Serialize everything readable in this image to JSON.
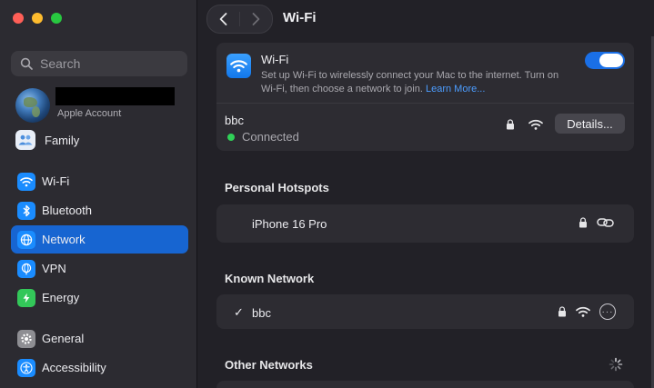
{
  "window": {
    "traffic_lights": {
      "close": "#ff5f57",
      "minimize": "#febc2e",
      "zoom": "#28c840"
    }
  },
  "sidebar": {
    "search": {
      "placeholder": "Search",
      "value": ""
    },
    "account": {
      "subtitle": "Apple Account"
    },
    "family": {
      "label": "Family"
    },
    "items": [
      {
        "label": "Wi-Fi",
        "icon": "wifi-icon",
        "color": "#1a8cff",
        "selected": false
      },
      {
        "label": "Bluetooth",
        "icon": "bluetooth-icon",
        "color": "#1a8cff",
        "selected": false
      },
      {
        "label": "Network",
        "icon": "globe-icon",
        "color": "#1a8cff",
        "selected": true
      },
      {
        "label": "VPN",
        "icon": "globe-vpn-icon",
        "color": "#1a8cff",
        "selected": false
      },
      {
        "label": "Energy",
        "icon": "energy-icon",
        "color": "#33c759",
        "selected": false
      },
      {
        "label": "General",
        "icon": "gear-icon",
        "color": "#8e8e93",
        "selected": false
      },
      {
        "label": "Accessibility",
        "icon": "accessibility-icon",
        "color": "#1a8cff",
        "selected": false
      }
    ]
  },
  "header": {
    "title": "Wi-Fi"
  },
  "wifi_panel": {
    "title": "Wi-Fi",
    "description": "Set up Wi-Fi to wirelessly connect your Mac to the internet. Turn on Wi-Fi, then choose a network to join.",
    "learn_more": "Learn More...",
    "enabled": true,
    "current_network": {
      "name": "bbc",
      "status": "Connected",
      "details_label": "Details..."
    }
  },
  "personal_hotspots": {
    "heading": "Personal Hotspots",
    "items": [
      {
        "name": "iPhone 16 Pro"
      }
    ]
  },
  "known_network": {
    "heading": "Known Network",
    "items": [
      {
        "name": "bbc",
        "check": "✓"
      }
    ]
  },
  "other_networks": {
    "heading": "Other Networks"
  },
  "accent_color": "#1765d1"
}
